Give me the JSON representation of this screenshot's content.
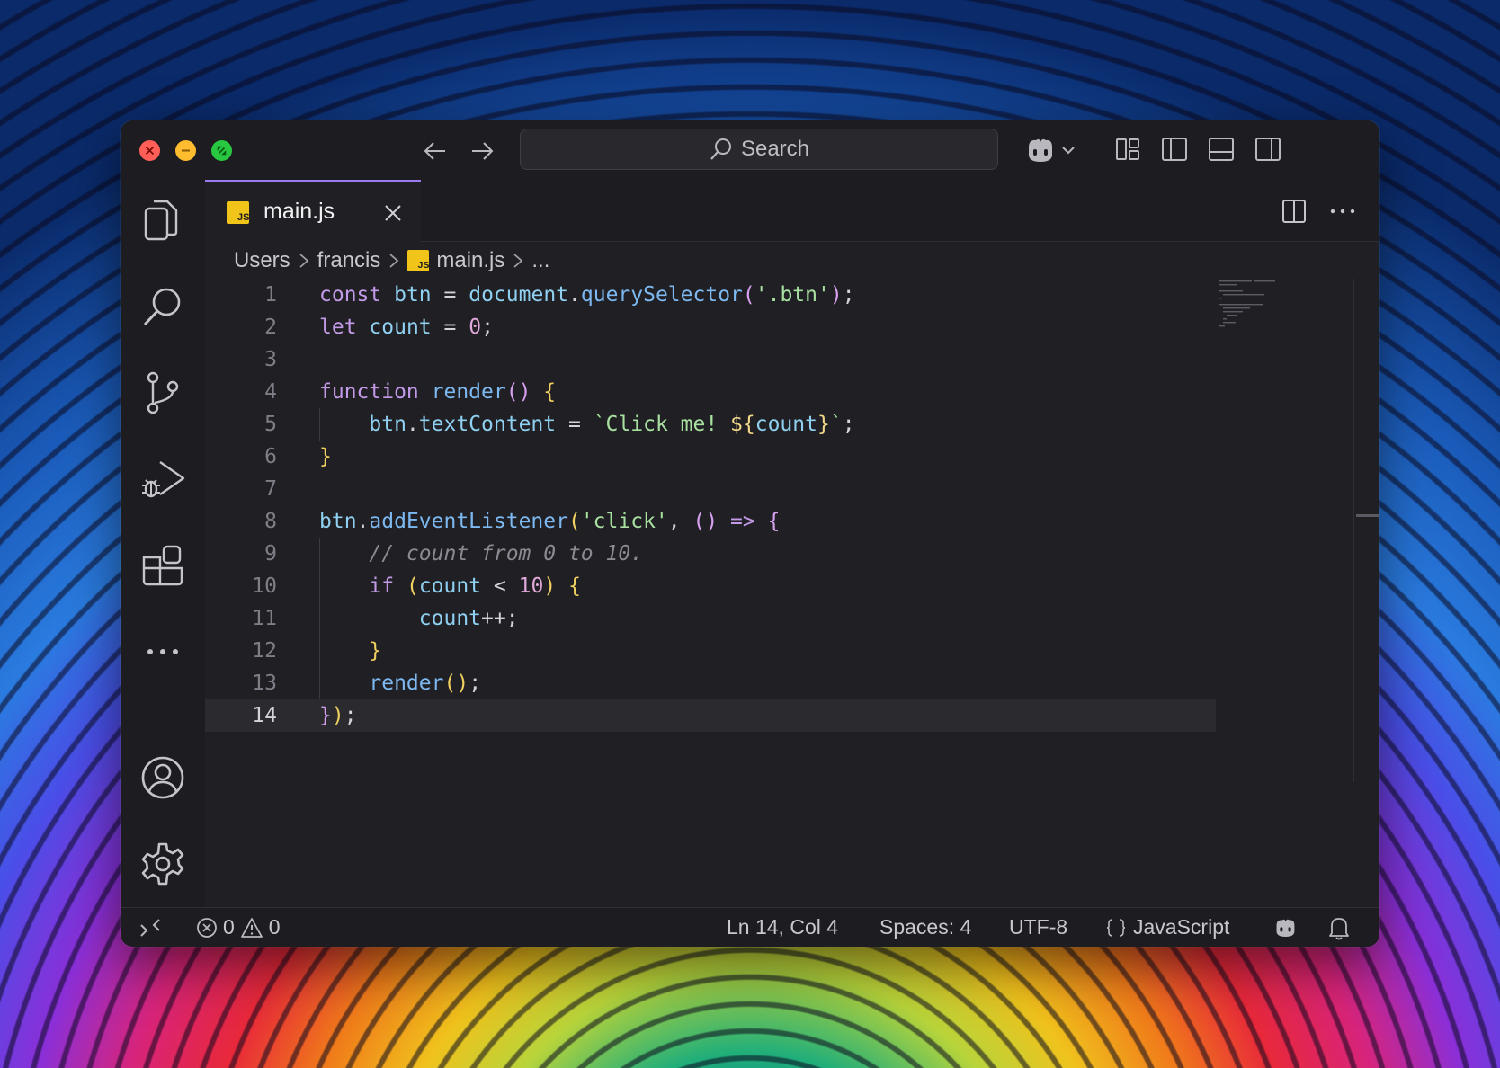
{
  "titlebar": {
    "search_label": "Search"
  },
  "tab": {
    "filename": "main.js",
    "icon_text": "JS"
  },
  "breadcrumb": {
    "items": [
      "Users",
      "francis",
      "main.js",
      "..."
    ]
  },
  "editor": {
    "current_line": 14,
    "line_numbers": [
      "1",
      "2",
      "3",
      "4",
      "5",
      "6",
      "7",
      "8",
      "9",
      "10",
      "11",
      "12",
      "13",
      "14"
    ],
    "lines": [
      "const btn = document.querySelector('.btn');",
      "let count = 0;",
      "",
      "function render() {",
      "    btn.textContent = `Click me! ${count}`;",
      "}",
      "",
      "btn.addEventListener('click', () => {",
      "    // count from 0 to 10.",
      "    if (count < 10) {",
      "        count++;",
      "    }",
      "    render();",
      "});"
    ]
  },
  "statusbar": {
    "errors": "0",
    "warnings": "0",
    "position": "Ln 14, Col 4",
    "spaces": "Spaces: 4",
    "encoding": "UTF-8",
    "language": "JavaScript"
  },
  "colors": {
    "keyword": "#c39ae8",
    "variable": "#8fd0f0",
    "function": "#7db8f0",
    "string": "#a8e0a0",
    "template": "#f0d78a",
    "number": "#e0a8d8",
    "comment": "#8a8a92",
    "tab_accent": "#9a7cf0",
    "js_icon": "#f0c419"
  }
}
